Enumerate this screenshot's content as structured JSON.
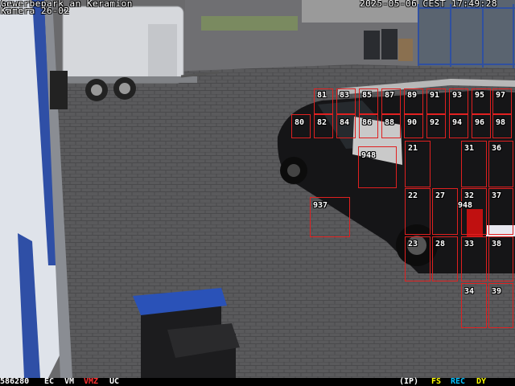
{
  "overlay": {
    "location": "Gewerbepark an Keramion",
    "camera": "Kamera 26-02",
    "datetime": "2025-05-06 CEST 17:49:28"
  },
  "status_bar": {
    "counter": "586280",
    "ec": "EC",
    "vm": "VM",
    "vmz": "VMZ",
    "uc": "UC",
    "ip": "(IP)",
    "fs": "FS",
    "rec": "REC",
    "dy": "DY"
  },
  "colors": {
    "box": "#e02020",
    "vmz": "#ff3030",
    "fs": "#ffff00",
    "rec": "#00c0ff",
    "dy": "#ffff00"
  },
  "zones": [
    {
      "label": "81"
    },
    {
      "label": "83"
    },
    {
      "label": "85"
    },
    {
      "label": "87"
    },
    {
      "label": "89"
    },
    {
      "label": "91"
    },
    {
      "label": "93"
    },
    {
      "label": "95"
    },
    {
      "label": "97"
    },
    {
      "label": "80"
    },
    {
      "label": "82"
    },
    {
      "label": "84"
    },
    {
      "label": "86"
    },
    {
      "label": "88"
    },
    {
      "label": "90"
    },
    {
      "label": "92"
    },
    {
      "label": "94"
    },
    {
      "label": "96"
    },
    {
      "label": "98"
    },
    {
      "label": "21"
    },
    {
      "label": "31"
    },
    {
      "label": "36"
    },
    {
      "label": "22"
    },
    {
      "label": "27"
    },
    {
      "label": "32"
    },
    {
      "label": "37"
    },
    {
      "label": "23"
    },
    {
      "label": "28"
    },
    {
      "label": "33"
    },
    {
      "label": "38"
    },
    {
      "label": "34"
    },
    {
      "label": "39"
    },
    {
      "label": "948"
    },
    {
      "label": "937"
    },
    {
      "label": "948"
    }
  ]
}
